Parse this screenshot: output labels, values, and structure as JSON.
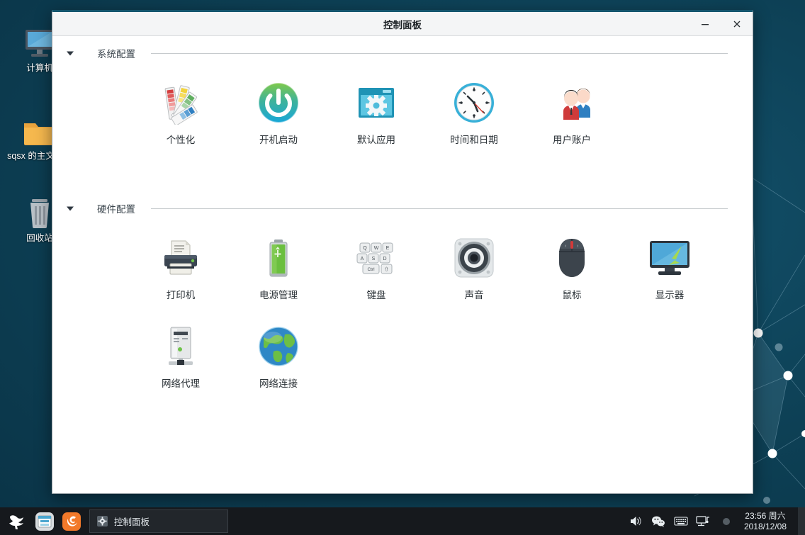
{
  "desktop": {
    "icons": [
      {
        "name": "computer",
        "label": "计算机",
        "icon": "monitor-icon"
      },
      {
        "name": "home-folder",
        "label": "sqsx 的主文件夹",
        "icon": "folder-icon"
      },
      {
        "name": "trash",
        "label": "回收站",
        "icon": "trash-icon"
      }
    ]
  },
  "window": {
    "title": "控制面板",
    "minimize_label": "最小化",
    "close_label": "关闭",
    "sections": [
      {
        "key": "system",
        "title": "系统配置",
        "expanded": true,
        "items": [
          {
            "label": "个性化",
            "icon": "palette-icon"
          },
          {
            "label": "开机启动",
            "icon": "power-icon"
          },
          {
            "label": "默认应用",
            "icon": "window-gear-icon"
          },
          {
            "label": "时间和日期",
            "icon": "clock-icon"
          },
          {
            "label": "用户账户",
            "icon": "users-icon"
          }
        ]
      },
      {
        "key": "hardware",
        "title": "硬件配置",
        "expanded": true,
        "items": [
          {
            "label": "打印机",
            "icon": "printer-icon"
          },
          {
            "label": "电源管理",
            "icon": "battery-icon"
          },
          {
            "label": "键盘",
            "icon": "keyboard-icon"
          },
          {
            "label": "声音",
            "icon": "speaker-icon"
          },
          {
            "label": "鼠标",
            "icon": "mouse-icon"
          },
          {
            "label": "显示器",
            "icon": "display-icon"
          },
          {
            "label": "网络代理",
            "icon": "server-icon"
          },
          {
            "label": "网络连接",
            "icon": "globe-icon"
          }
        ]
      }
    ]
  },
  "taskbar": {
    "launchers": [
      {
        "name": "start-menu",
        "icon": "fox-logo-icon",
        "label": "开始"
      },
      {
        "name": "file-manager",
        "icon": "file-manager-icon",
        "label": "文件管理器"
      },
      {
        "name": "firefox",
        "icon": "firefox-icon",
        "label": "Firefox"
      }
    ],
    "tasks": [
      {
        "label": "控制面板",
        "icon": "gear-icon",
        "active": true
      }
    ],
    "tray": [
      {
        "name": "volume",
        "icon": "volume-icon"
      },
      {
        "name": "wechat",
        "icon": "wechat-icon"
      },
      {
        "name": "input-method",
        "icon": "keyboard-tray-icon"
      },
      {
        "name": "network",
        "icon": "network-icon"
      }
    ],
    "clock": {
      "time": "23:56 周六",
      "date": "2018/12/08"
    }
  },
  "colors": {
    "desktop_bg": "#0d4055",
    "window_accent": "#14566e",
    "titlebar_bg": "#f4f5f6",
    "taskbar_bg": "#16191d",
    "label_text": "#2c3338"
  }
}
